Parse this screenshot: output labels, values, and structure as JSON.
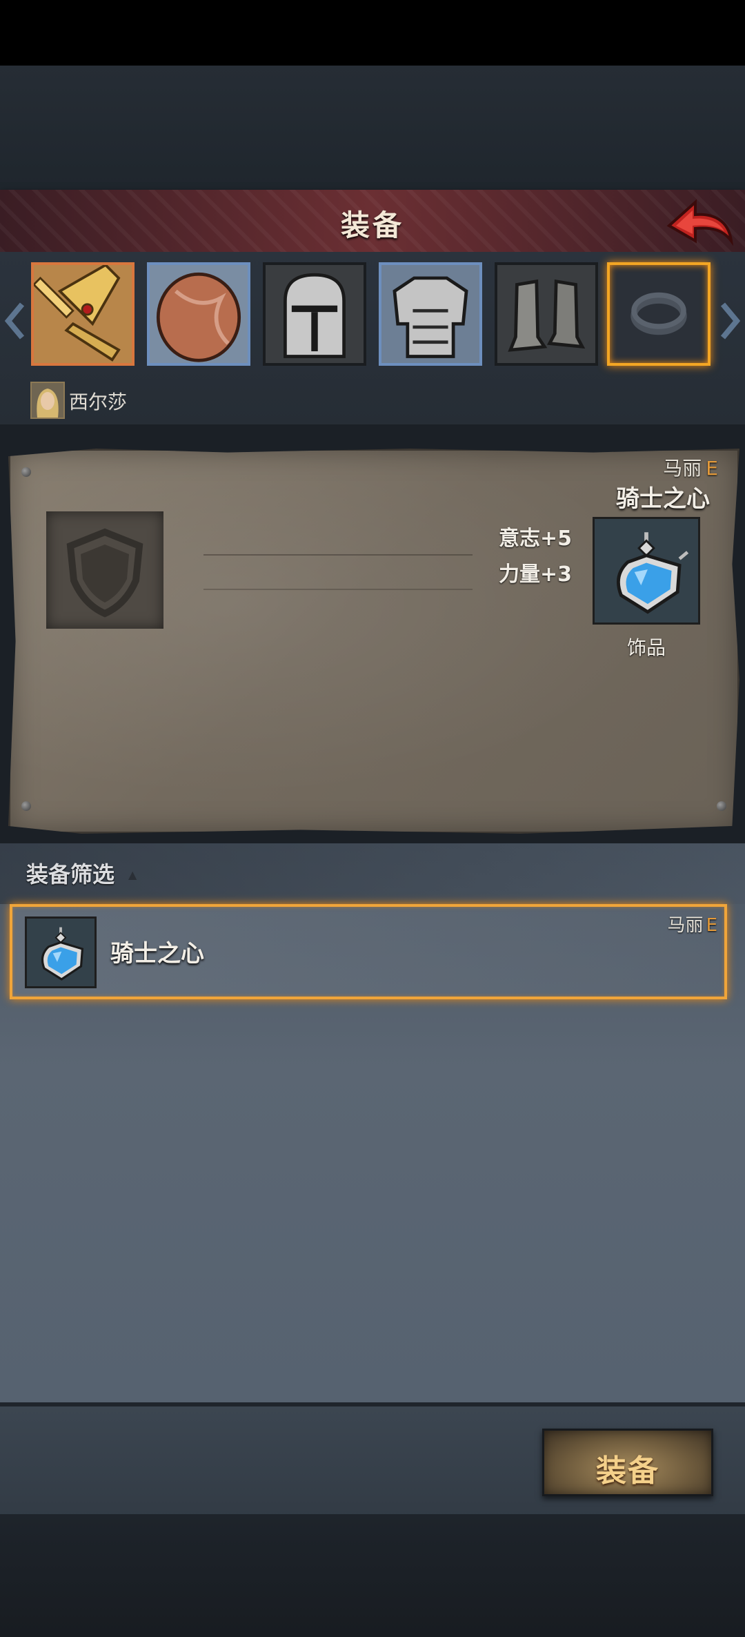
{
  "header": {
    "title": "装备"
  },
  "character": {
    "name": "西尔莎"
  },
  "equipment_slots": [
    {
      "name": "sword-icon",
      "border": "#d8773e"
    },
    {
      "name": "shield-icon",
      "border": "#6d8fbe"
    },
    {
      "name": "helmet-icon",
      "border": "#1a1d20"
    },
    {
      "name": "armor-icon",
      "border": "#6d8fbe"
    },
    {
      "name": "boots-icon",
      "border": "#1a1d20"
    },
    {
      "name": "ring-icon",
      "border": "#f3a624",
      "selected": true
    }
  ],
  "detail": {
    "owner": "马丽",
    "grade": "E",
    "item_name": "骑士之心",
    "stats": [
      "意志+5",
      "力量+3"
    ],
    "item_type": "饰品",
    "icon": "heart-pendant-icon"
  },
  "filter": {
    "label": "装备筛选",
    "toggle": "▲"
  },
  "items": [
    {
      "name": "骑士之心",
      "owner": "马丽",
      "grade": "E",
      "icon": "heart-pendant-icon"
    }
  ],
  "footer": {
    "equip_button": "装备"
  },
  "colors": {
    "accent": "#f0a53a",
    "grade": "#e39a3a",
    "banner": "#6b2f33"
  }
}
